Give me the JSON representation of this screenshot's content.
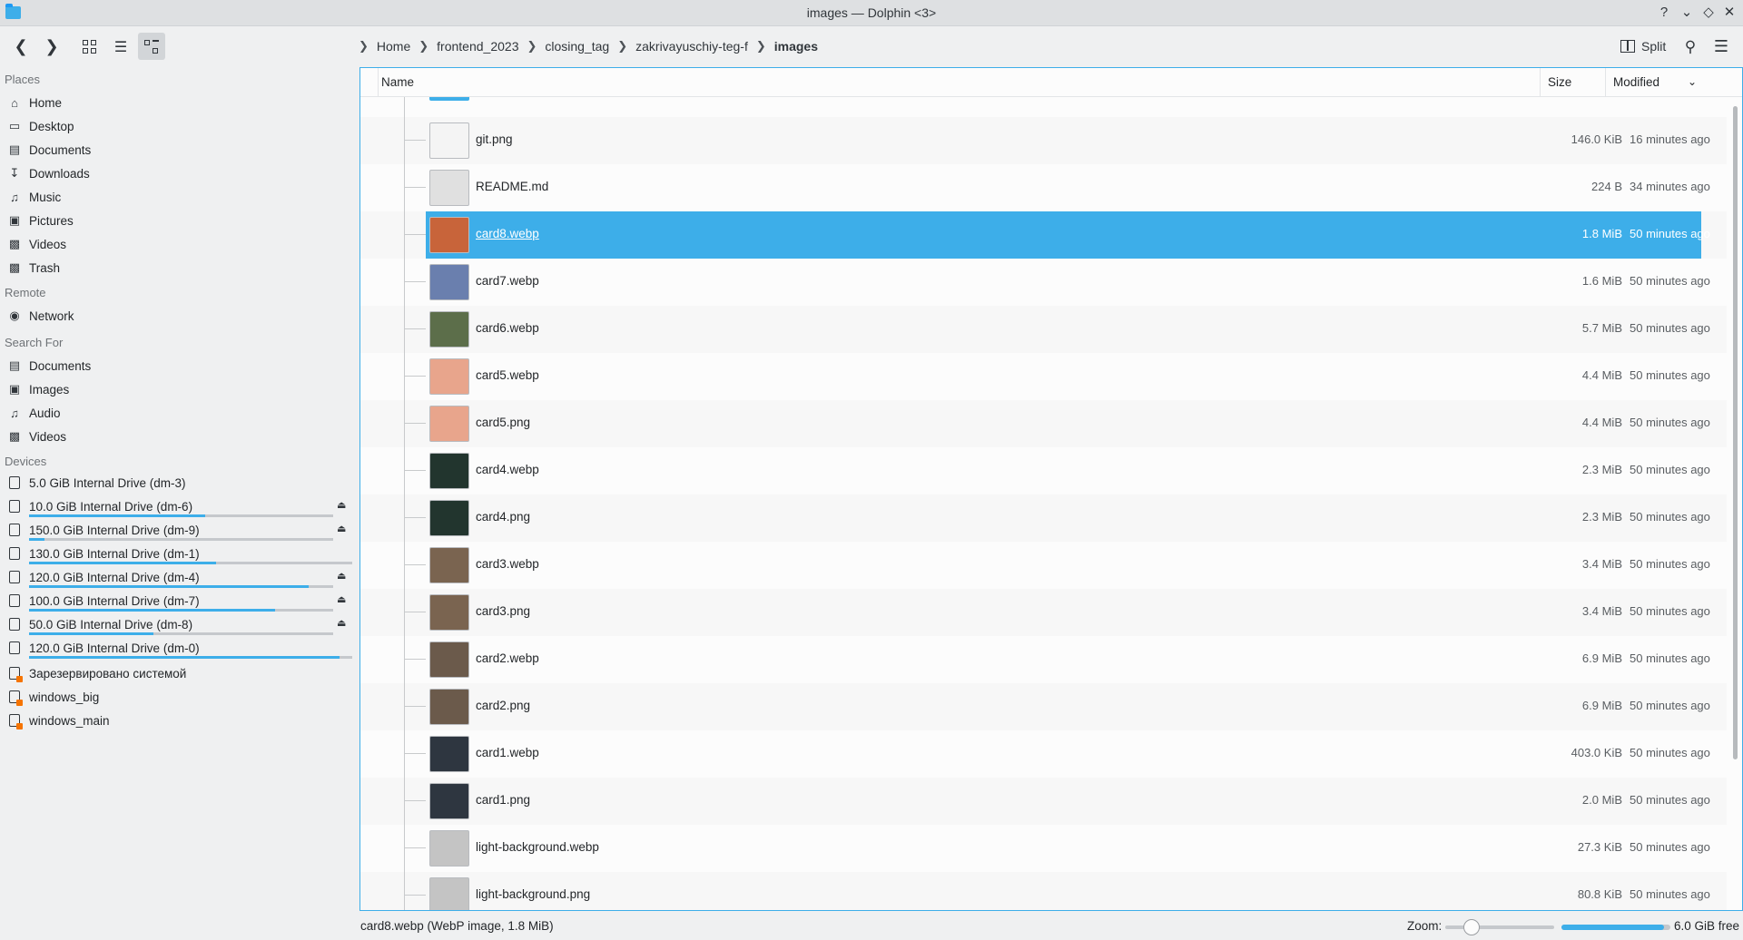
{
  "window": {
    "title": "images — Dolphin <3>"
  },
  "toolbar": {
    "back_icon": "chevron-left-icon",
    "forward_icon": "chevron-right-icon",
    "split_label": "Split",
    "breadcrumb": [
      "Home",
      "frontend_2023",
      "closing_tag",
      "zakrivayuschiy-teg-f",
      "images"
    ]
  },
  "sidebar": {
    "places_title": "Places",
    "places": [
      {
        "label": "Home",
        "icon": "home-icon"
      },
      {
        "label": "Desktop",
        "icon": "desktop-icon"
      },
      {
        "label": "Documents",
        "icon": "documents-icon"
      },
      {
        "label": "Downloads",
        "icon": "downloads-icon"
      },
      {
        "label": "Music",
        "icon": "music-icon"
      },
      {
        "label": "Pictures",
        "icon": "pictures-icon"
      },
      {
        "label": "Videos",
        "icon": "videos-icon"
      },
      {
        "label": "Trash",
        "icon": "trash-icon"
      }
    ],
    "remote_title": "Remote",
    "remote": [
      {
        "label": "Network",
        "icon": "network-icon"
      }
    ],
    "search_title": "Search For",
    "search": [
      {
        "label": "Documents",
        "icon": "documents-icon"
      },
      {
        "label": "Images",
        "icon": "images-icon"
      },
      {
        "label": "Audio",
        "icon": "audio-icon"
      },
      {
        "label": "Videos",
        "icon": "videos-icon"
      }
    ],
    "devices_title": "Devices",
    "devices": [
      {
        "label": "5.0 GiB Internal Drive (dm-3)",
        "usage": null,
        "eject": false,
        "win": false
      },
      {
        "label": "10.0 GiB Internal Drive (dm-6)",
        "usage": 0.58,
        "eject": true,
        "win": false
      },
      {
        "label": "150.0 GiB Internal Drive (dm-9)",
        "usage": 0.05,
        "eject": true,
        "win": false
      },
      {
        "label": "130.0 GiB Internal Drive (dm-1)",
        "usage": 0.58,
        "eject": false,
        "win": false
      },
      {
        "label": "120.0 GiB Internal Drive (dm-4)",
        "usage": 0.92,
        "eject": true,
        "win": false
      },
      {
        "label": "100.0 GiB Internal Drive (dm-7)",
        "usage": 0.81,
        "eject": true,
        "win": false
      },
      {
        "label": "50.0 GiB Internal Drive (dm-8)",
        "usage": 0.41,
        "eject": true,
        "win": false
      },
      {
        "label": "120.0 GiB Internal Drive (dm-0)",
        "usage": 0.96,
        "eject": false,
        "win": false
      },
      {
        "label": "Зарезервировано системой",
        "usage": null,
        "eject": false,
        "win": true
      },
      {
        "label": "windows_big",
        "usage": null,
        "eject": false,
        "win": true
      },
      {
        "label": "windows_main",
        "usage": null,
        "eject": false,
        "win": true
      }
    ]
  },
  "columns": {
    "name": "Name",
    "size": "Size",
    "modified": "Modified"
  },
  "files": [
    {
      "name": "git.png",
      "size": "146.0 KiB",
      "modified": "16 minutes ago",
      "thumb": "#f4f4f4",
      "selected": false
    },
    {
      "name": "README.md",
      "size": "224 B",
      "modified": "34 minutes ago",
      "thumb": "#e0e0e0",
      "selected": false
    },
    {
      "name": "card8.webp",
      "size": "1.8 MiB",
      "modified": "50 minutes ago",
      "thumb": "#c8643a",
      "selected": true
    },
    {
      "name": "card7.webp",
      "size": "1.6 MiB",
      "modified": "50 minutes ago",
      "thumb": "#6a7fae",
      "selected": false
    },
    {
      "name": "card6.webp",
      "size": "5.7 MiB",
      "modified": "50 minutes ago",
      "thumb": "#5c6e4a",
      "selected": false
    },
    {
      "name": "card5.webp",
      "size": "4.4 MiB",
      "modified": "50 minutes ago",
      "thumb": "#e8a58c",
      "selected": false
    },
    {
      "name": "card5.png",
      "size": "4.4 MiB",
      "modified": "50 minutes ago",
      "thumb": "#e8a58c",
      "selected": false
    },
    {
      "name": "card4.webp",
      "size": "2.3 MiB",
      "modified": "50 minutes ago",
      "thumb": "#22352e",
      "selected": false
    },
    {
      "name": "card4.png",
      "size": "2.3 MiB",
      "modified": "50 minutes ago",
      "thumb": "#22352e",
      "selected": false
    },
    {
      "name": "card3.webp",
      "size": "3.4 MiB",
      "modified": "50 minutes ago",
      "thumb": "#7a6450",
      "selected": false
    },
    {
      "name": "card3.png",
      "size": "3.4 MiB",
      "modified": "50 minutes ago",
      "thumb": "#7a6450",
      "selected": false
    },
    {
      "name": "card2.webp",
      "size": "6.9 MiB",
      "modified": "50 minutes ago",
      "thumb": "#6b5a4b",
      "selected": false
    },
    {
      "name": "card2.png",
      "size": "6.9 MiB",
      "modified": "50 minutes ago",
      "thumb": "#6b5a4b",
      "selected": false
    },
    {
      "name": "card1.webp",
      "size": "403.0 KiB",
      "modified": "50 minutes ago",
      "thumb": "#2e3640",
      "selected": false
    },
    {
      "name": "card1.png",
      "size": "2.0 MiB",
      "modified": "50 minutes ago",
      "thumb": "#2e3640",
      "selected": false
    },
    {
      "name": "light-background.webp",
      "size": "27.3 KiB",
      "modified": "50 minutes ago",
      "thumb": "#c4c4c4",
      "selected": false
    },
    {
      "name": "light-background.png",
      "size": "80.8 KiB",
      "modified": "50 minutes ago",
      "thumb": "#c4c4c4",
      "selected": false
    }
  ],
  "statusbar": {
    "status_text": "card8.webp (WebP image, 1.8 MiB)",
    "zoom_label": "Zoom:",
    "free_text": "6.0 GiB free",
    "space_usage": 0.94
  },
  "colors": {
    "accent": "#3daee9"
  }
}
